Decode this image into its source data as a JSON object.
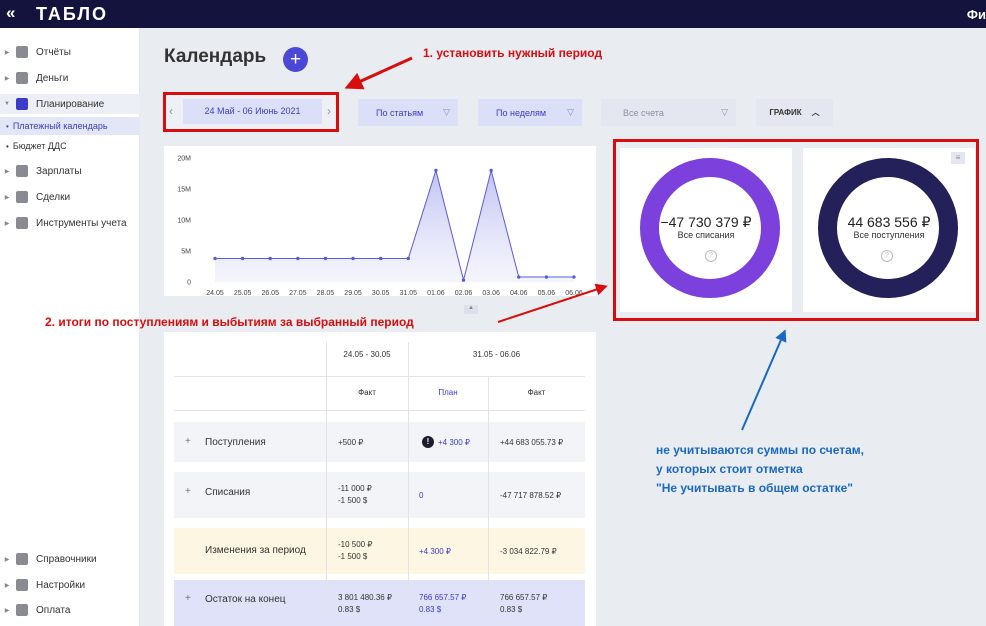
{
  "app": {
    "logo": "ТАБЛО",
    "collapse_icon": "«",
    "user_partial": "Фи"
  },
  "sidebar": {
    "items": [
      {
        "label": "Отчёты",
        "icon": "bar-chart-icon"
      },
      {
        "label": "Деньги",
        "icon": "wallet-icon"
      },
      {
        "label": "Планирование",
        "icon": "planning-icon"
      },
      {
        "label": "Зарплаты",
        "icon": "person-icon"
      },
      {
        "label": "Сделки",
        "icon": "briefcase-icon"
      },
      {
        "label": "Инструменты учета",
        "icon": "tools-icon"
      }
    ],
    "sub_items": [
      "Платежный календарь",
      "Бюджет ДДС"
    ],
    "bottom_items": [
      {
        "label": "Справочники",
        "icon": "book-icon"
      },
      {
        "label": "Настройки",
        "icon": "gear-icon"
      },
      {
        "label": "Оплата",
        "icon": "card-icon"
      }
    ]
  },
  "page": {
    "title": "Календарь",
    "add_label": "+"
  },
  "filters": {
    "period": "24 Май - 06 Июнь 2021",
    "group": "По статьям",
    "step": "По неделям",
    "accounts": "Все счета",
    "graph": "ГРАФИК"
  },
  "chart_data": {
    "type": "line",
    "categories": [
      "24.05",
      "25.05",
      "26.05",
      "27.05",
      "28.05",
      "29.05",
      "30.05",
      "31.05",
      "01.06",
      "02.06",
      "03.06",
      "04.06",
      "05.06",
      "06.06"
    ],
    "series": [
      {
        "values": [
          3.8,
          3.8,
          3.8,
          3.8,
          3.8,
          3.8,
          3.8,
          3.8,
          18.0,
          0.3,
          18.0,
          0.8,
          0.8,
          0.8
        ]
      }
    ],
    "yticks": [
      "0",
      "5M",
      "10M",
      "15M",
      "20M"
    ],
    "ylim": [
      0,
      20
    ],
    "grid": false,
    "color": "#5b5bd6"
  },
  "kpis": {
    "expenses": {
      "value": "−47 730 379 ₽",
      "label": "Все списания",
      "color": "#7c40dd"
    },
    "income": {
      "value": "44 683 556 ₽",
      "label": "Все поступления",
      "color": "#23205a"
    }
  },
  "table": {
    "weeks": [
      "24.05 - 30.05",
      "31.05 - 06.06"
    ],
    "cols": [
      "Факт",
      "План",
      "Факт"
    ],
    "rows": [
      {
        "label": "Поступления",
        "c1": [
          "+500 ₽"
        ],
        "c2": [
          "+4 300 ₽"
        ],
        "c3": [
          "+44 683 055.73 ₽"
        ]
      },
      {
        "label": "Списания",
        "c1": [
          "-11 000 ₽",
          "-1 500 $"
        ],
        "c2": [
          "0"
        ],
        "c3": [
          "-47 717 878.52 ₽"
        ]
      },
      {
        "label": "Изменения за период",
        "c1": [
          "-10 500 ₽",
          "-1 500 $"
        ],
        "c2": [
          "+4 300 ₽"
        ],
        "c3": [
          "-3 034 822.79 ₽"
        ]
      },
      {
        "label": "Остаток на конец",
        "c1": [
          "3 801 480.36 ₽",
          "0.83 $"
        ],
        "c2": [
          "766 657.57 ₽",
          "0.83 $"
        ],
        "c3": [
          "766 657.57 ₽",
          "0.83 $"
        ]
      }
    ]
  },
  "annotations": {
    "step1": "1. установить нужный период",
    "step2": "2. итоги по поступлениям и выбытиям за выбранный период",
    "note_lines": [
      "не учитываются суммы по счетам,",
      "у которых стоит отметка",
      "\"Не учитывать в общем остатке\""
    ]
  }
}
